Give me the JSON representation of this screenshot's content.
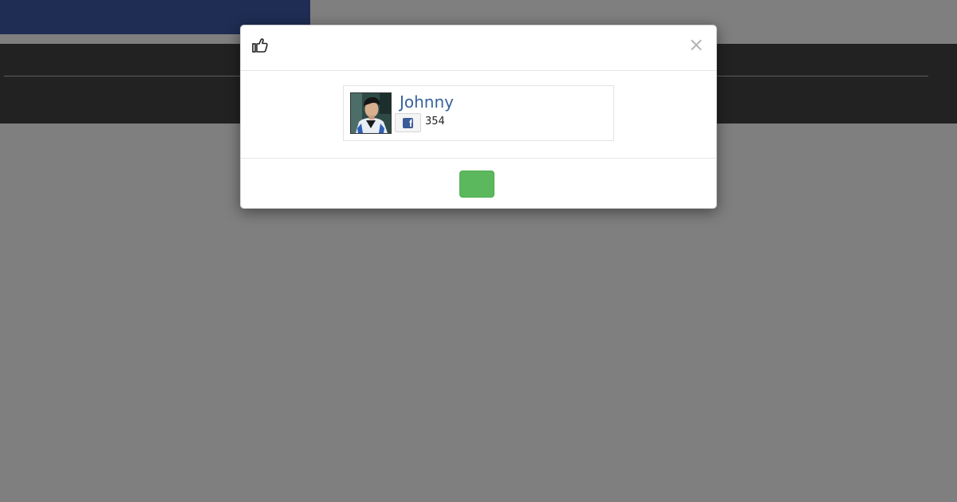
{
  "modal": {
    "header_icon": "thumbs-up-icon",
    "close_label": "×",
    "user": {
      "name": "Johnny",
      "avatar_icon": "user-photo",
      "social_icon": "facebook-icon",
      "like_count": "354"
    },
    "footer": {
      "confirm_label": ""
    }
  },
  "colors": {
    "banner": "#3f5aa8",
    "dark_band": "#444444",
    "user_name": "#37629c",
    "facebook": "#3b5a98",
    "confirm_button": "#5cb85c"
  }
}
